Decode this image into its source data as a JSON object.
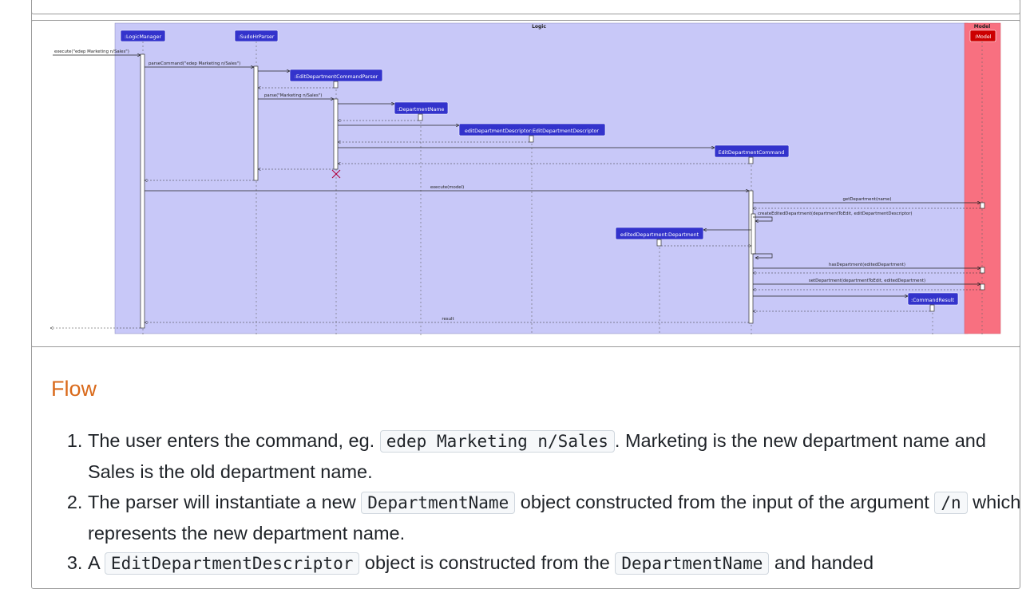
{
  "diagram": {
    "frame_title": "Logic",
    "model_frame_title": "Model",
    "participants": [
      ":LogicManager",
      ":SudoHrParser",
      ":EditDepartmentCommandParser",
      ":DepartmentName",
      "editDepartmentDescriptor:EditDepartmentDescriptor",
      "EditDepartmentCommand",
      "editedDepartment:Department",
      ":CommandResult",
      ":Model"
    ],
    "messages": {
      "execute_cmd": "execute(\"edep Marketing n/Sales\")",
      "parse_command": "parseCommand(\"edep Marketing n/Sales\")",
      "parse": "parse(\"Marketing n/Sales\")",
      "execute_model": "execute(model)",
      "get_department": "getDepartment(name)",
      "create_edited": "createEditedDepartment(departmentToEdit, editDepartmentDescriptor)",
      "has_department": "hasDepartment(editedDepartment)",
      "set_department": "setDepartment(departmentToEdit, editedDepartment)",
      "result": "result"
    },
    "colors": {
      "logic_fill": "#c8c8f8",
      "model_fill": "#f87080",
      "participant_fill": "#3333cc",
      "model_participant_fill": "#cc0000",
      "destroy_mark": "#b0003a"
    }
  },
  "flow": {
    "heading": "Flow",
    "steps": [
      {
        "pre": "The user enters the command, eg. ",
        "code": "edep Marketing n/Sales",
        "post": ". Marketing is the new department name and Sales is the old department name."
      },
      {
        "pre": "The parser will instantiate a new ",
        "code": "DepartmentName",
        "mid": " object constructed from the input of the argument ",
        "code2": "/n",
        "post": " which represents the new department name."
      },
      {
        "pre": "A ",
        "code": "EditDepartmentDescriptor",
        "mid": " object is constructed from the ",
        "code2": "DepartmentName",
        "post": " and handed"
      }
    ]
  }
}
